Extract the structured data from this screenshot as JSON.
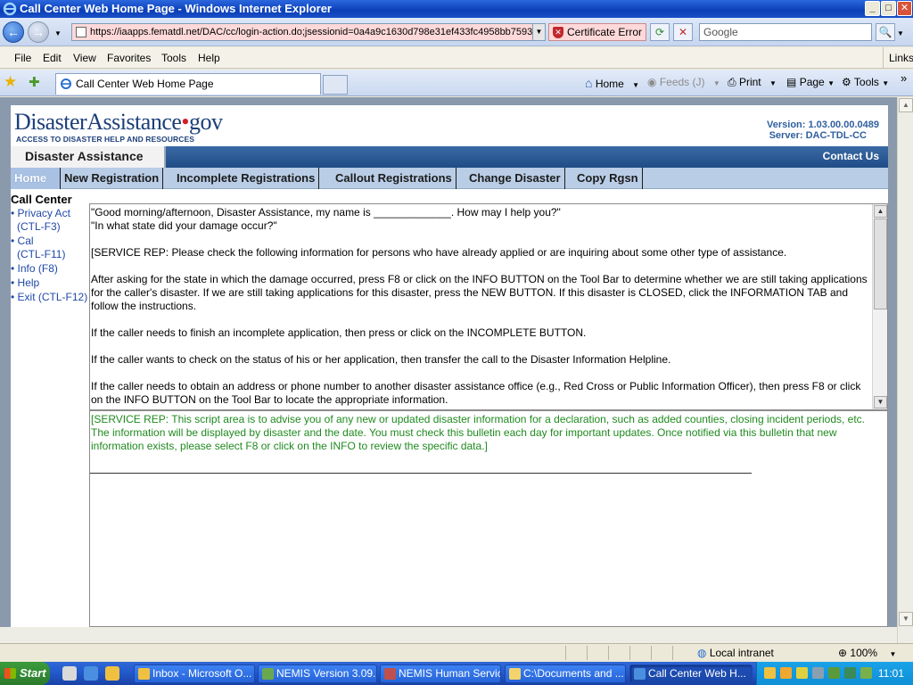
{
  "window": {
    "title": "Call Center Web Home Page - Windows Internet Explorer",
    "controls": {
      "minimize": "_",
      "maximize": "□",
      "close": "✕"
    }
  },
  "addressbar": {
    "url": "https://iaapps.fematdl.net/DAC/cc/login-action.do;jsessionid=0a4a9c1630d798e31ef433fc4958bb7593",
    "cert_error": "Certificate Error",
    "search_placeholder": "Google",
    "back_glyph": "←",
    "forward_glyph": "→",
    "refresh_glyph": "⟳",
    "stop_glyph": "✕",
    "search_glyph": "🔍"
  },
  "menubar": {
    "items": [
      "File",
      "Edit",
      "View",
      "Favorites",
      "Tools",
      "Help"
    ],
    "links": "Links"
  },
  "tabbar": {
    "tab_title": "Call Center Web Home Page",
    "home": "Home",
    "feeds": "Feeds (J)",
    "print": "Print",
    "page": "Page",
    "tools": "Tools",
    "star_glyph": "★",
    "add_fav_glyph": "✚",
    "home_glyph": "⌂",
    "feeds_glyph": "◉",
    "print_glyph": "⎙",
    "page_glyph": "▤",
    "tools_glyph": "⚙",
    "more_glyph": "»"
  },
  "site": {
    "logo_main": "DisasterAssistance",
    "logo_dot": "•",
    "logo_tld": "gov",
    "logo_sub": "ACCESS TO DISASTER HELP AND RESOURCES",
    "version": "Version: 1.03.00.00.0489",
    "server": "Server: DAC-TDL-CC",
    "banner_title": "Disaster Assistance",
    "contact": "Contact Us",
    "nav": [
      "Home",
      "New Registration",
      "Incomplete Registrations",
      "Callout Registrations",
      "Change Disaster",
      "Copy Rgsn"
    ],
    "sidebar": {
      "heading": "Call Center",
      "links": [
        {
          "line1": "Privacy Act",
          "line2": "(CTL-F3)"
        },
        {
          "line1": "Cal",
          "line2": "(CTL-F11)"
        },
        {
          "line1": "Info (F8)",
          "line2": ""
        },
        {
          "line1": "Help",
          "line2": ""
        },
        {
          "line1": "Exit (CTL-F12)",
          "line2": ""
        }
      ]
    },
    "script": {
      "greeting1": "\"Good morning/afternoon, Disaster Assistance, my name is _____________. How may I help you?\"",
      "greeting2": "\"In what state did your damage occur?\"",
      "para1": "[SERVICE REP: Please check the following information for persons who have already applied or are inquiring about some other type of assistance.",
      "para2": "After asking for the state in which the damage occurred, press F8 or click on the INFO BUTTON on the Tool Bar to determine whether we are still taking applications for the caller's disaster. If we are still taking applications for this disaster, press the NEW BUTTON. If this disaster is CLOSED, click the INFORMATION TAB and follow the instructions.",
      "para3": "If the caller needs to finish an incomplete application, then press or click on the INCOMPLETE BUTTON.",
      "para4": "If the caller wants to check on the status of his or her application, then transfer the call to the Disaster Information Helpline.",
      "para5": "If the caller needs to obtain an address or phone number to another disaster assistance office (e.g., Red Cross or Public Information Officer), then press F8 or click on the INFO BUTTON on the Tool Bar to locate the appropriate information."
    },
    "bulletin": "[SERVICE REP: This script area is to advise you of any new or updated disaster information for a declaration, such as added counties, closing incident periods, etc. The information will be displayed by disaster and the date. You must check this bulletin each day for important updates. Once notified via this bulletin that new information exists, please select F8 or click on the INFO to review the specific data.]"
  },
  "statusbar": {
    "zone": "Local intranet",
    "zoom": "100%"
  },
  "taskbar": {
    "start": "Start",
    "tasks": [
      "Inbox - Microsoft O...",
      "NEMIS Version 3.09....",
      "NEMIS Human Servic...",
      "C:\\Documents and ...",
      "Call Center Web H..."
    ],
    "clock": "11:01"
  }
}
